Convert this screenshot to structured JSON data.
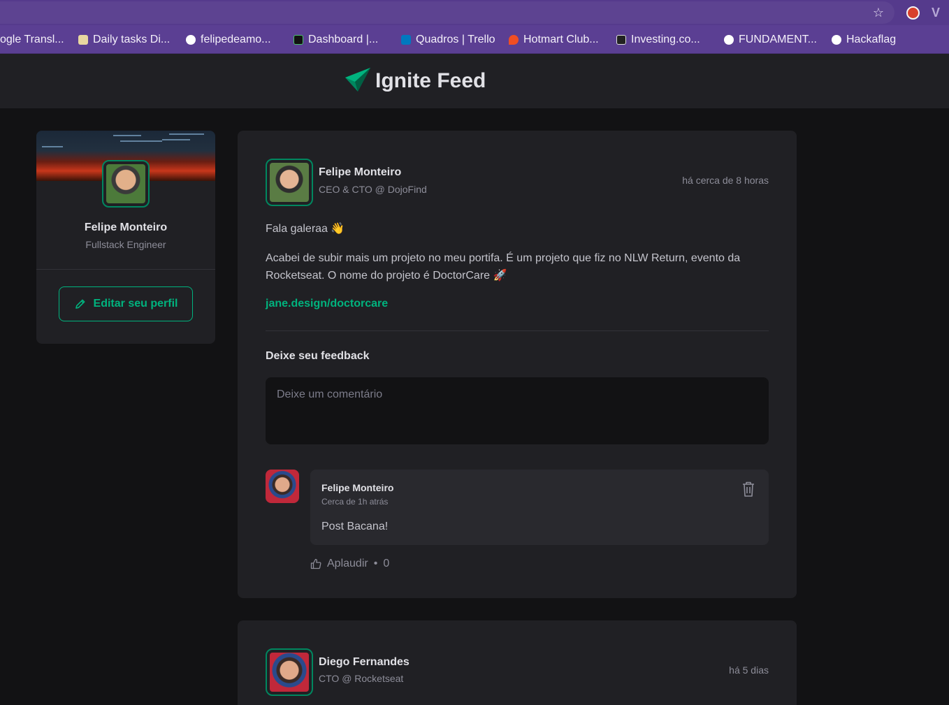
{
  "browser": {
    "bookmarks": [
      {
        "label": "ogle Transl...",
        "icon": "google-translate-icon",
        "color": "#4285f4"
      },
      {
        "label": "Daily tasks Di...",
        "icon": "notepad-icon",
        "color": "#e8d7a0"
      },
      {
        "label": "felipedeamo...",
        "icon": "github-icon",
        "color": "#ffffff"
      },
      {
        "label": "Dashboard |...",
        "icon": "dashboard-icon",
        "color": "#1b1b1b"
      },
      {
        "label": "Quadros | Trello",
        "icon": "trello-icon",
        "color": "#0079bf"
      },
      {
        "label": "Hotmart Club...",
        "icon": "hotmart-icon",
        "color": "#f04e23"
      },
      {
        "label": "Investing.co...",
        "icon": "investing-icon",
        "color": "#222222"
      },
      {
        "label": "FUNDAMENT...",
        "icon": "globe-icon",
        "color": "#ffffff"
      },
      {
        "label": "Hackaflag",
        "icon": "globe-icon",
        "color": "#ffffff"
      }
    ]
  },
  "app": {
    "title": "Ignite Feed",
    "accent": "#00b37e"
  },
  "sidebar": {
    "name": "Felipe Monteiro",
    "role": "Fullstack Engineer",
    "edit_label": "Editar seu perfil"
  },
  "post": {
    "author": "Felipe Monteiro",
    "role": "CEO & CTO @ DojoFind",
    "time": "há cerca de 8 horas",
    "paragraph1": "Fala galeraa 👋",
    "paragraph2": "Acabei de subir mais um projeto no meu portifa. É um projeto que fiz no NLW Return, evento da Rocketseat. O nome do projeto é DoctorCare 🚀",
    "link": "jane.design/doctorcare",
    "feedback_title": "Deixe seu feedback",
    "comment_placeholder": "Deixe um comentário",
    "comment": {
      "author": "Felipe Monteiro",
      "time": "Cerca de 1h atrás",
      "text": "Post Bacana!",
      "applaud_label": "Aplaudir",
      "applaud_count": "0"
    }
  },
  "post2": {
    "author": "Diego Fernandes",
    "role": "CTO @ Rocketseat",
    "time": "há 5 dias"
  }
}
